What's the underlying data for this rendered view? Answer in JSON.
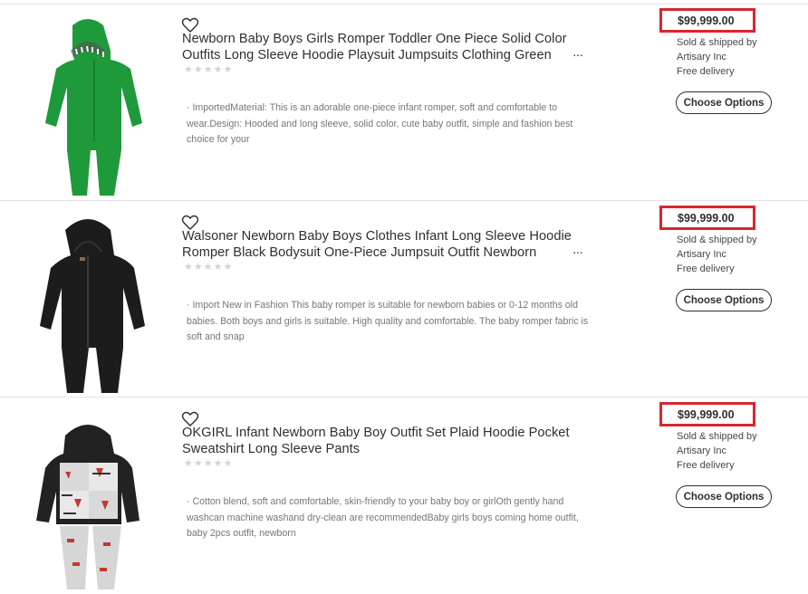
{
  "products": [
    {
      "title": "Newborn Baby Boys Girls Romper Toddler One Piece Solid Color Outfits Long Sleeve Hoodie Playsuit Jumpsuits Clothing Green",
      "rating_stars": "★★★★★",
      "description": "· ImportedMaterial: This is an adorable one-piece infant romper, soft and comfortable to wear.Design: Hooded and long sleeve, solid color, cute baby outfit, simple and fashion best choice for your",
      "price": "$99,999.00",
      "seller_line1": "Sold & shipped by",
      "seller_line2": "Artisary Inc",
      "delivery": "Free delivery",
      "button_label": "Choose Options",
      "more_label": "···",
      "image_icon": "green-romper-image",
      "color": "#1e9a3b"
    },
    {
      "title": "Walsoner Newborn Baby Boys Clothes Infant Long Sleeve Hoodie Romper Black Bodysuit One-Piece Jumpsuit Outfit Newborn",
      "rating_stars": "★★★★★",
      "description": "· Import New in Fashion This baby romper is suitable for newborn babies or 0-12 months old babies. Both boys and girls is suitable. High quality and comfortable. The baby romper fabric is soft and snap",
      "price": "$99,999.00",
      "seller_line1": "Sold & shipped by",
      "seller_line2": "Artisary Inc",
      "delivery": "Free delivery",
      "button_label": "Choose Options",
      "more_label": "···",
      "image_icon": "black-romper-image",
      "color": "#1c1c1c"
    },
    {
      "title": "OKGIRL Infant Newborn Baby Boy Outfit Set Plaid Hoodie Pocket Sweatshirt Long Sleeve Pants",
      "rating_stars": "★★★★★",
      "description": "· Cotton blend, soft and comfortable, skin-friendly to your baby boy or girlOth gently hand washcan machine washand dry-clean are recommendedBaby girls boys coming home outfit, baby 2pcs outfit, newborn",
      "price": "$99,999.00",
      "seller_line1": "Sold & shipped by",
      "seller_line2": "Artisary Inc",
      "delivery": "Free delivery",
      "button_label": "Choose Options",
      "more_label": "···",
      "image_icon": "plaid-outfit-image",
      "color": "#222222"
    }
  ],
  "colors": {
    "price_highlight_border": "#d8262f",
    "text_primary": "#2e2f32",
    "text_secondary": "#74767c"
  }
}
